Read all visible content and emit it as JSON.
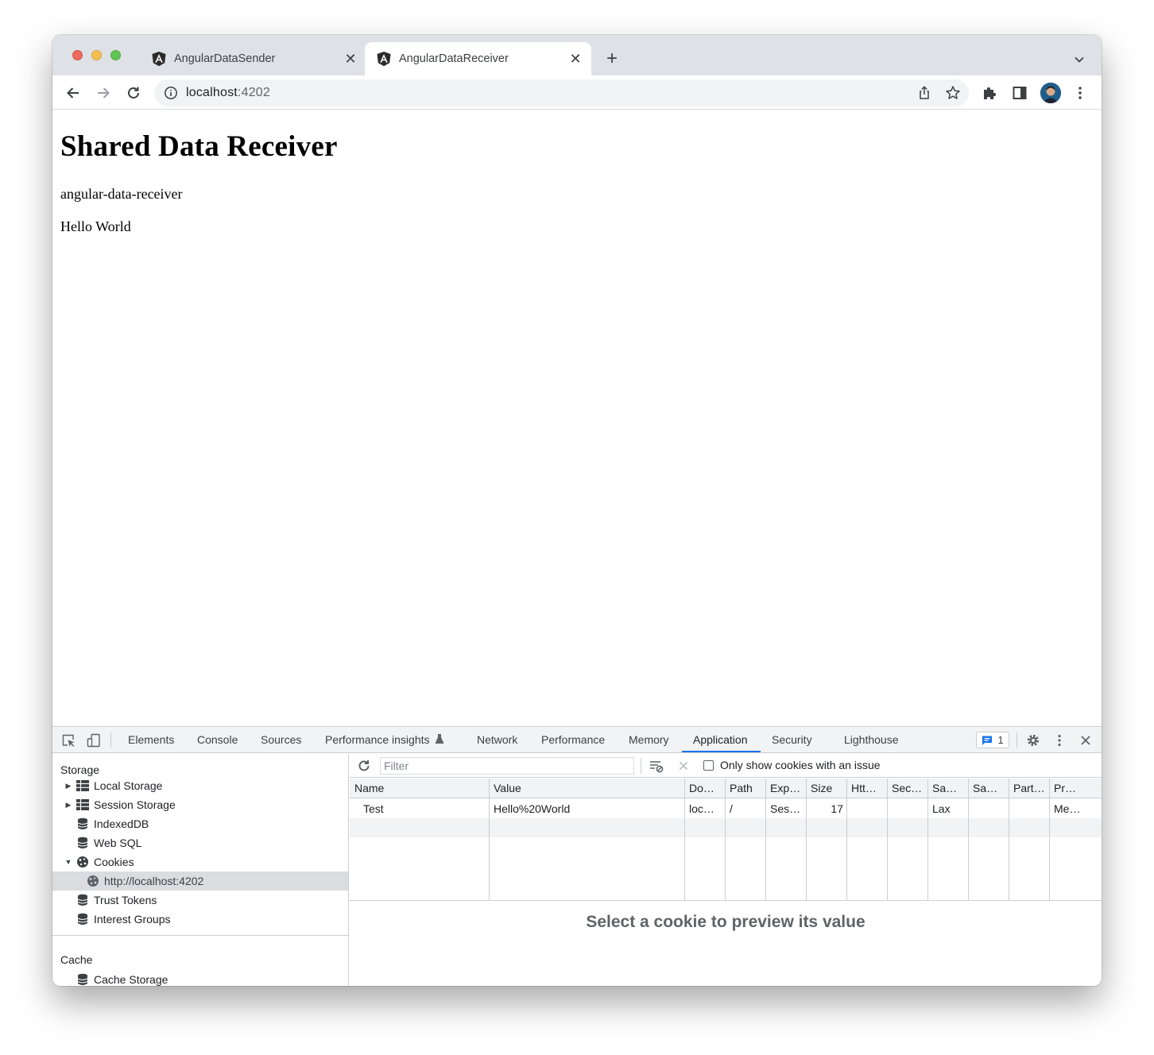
{
  "browser": {
    "tabs": [
      {
        "title": "AngularDataSender",
        "active": false
      },
      {
        "title": "AngularDataReceiver",
        "active": true
      }
    ],
    "url_host": "localhost",
    "url_port": ":4202"
  },
  "page": {
    "heading": "Shared Data Receiver",
    "app_name": "angular-data-receiver",
    "message": "Hello World"
  },
  "devtools": {
    "tabs": [
      "Elements",
      "Console",
      "Sources",
      "Performance insights",
      "Network",
      "Performance",
      "Memory",
      "Application",
      "Security",
      "Lighthouse"
    ],
    "active_tab": "Application",
    "issues_count": "1",
    "sidebar": {
      "storage_heading": "Storage",
      "items": [
        {
          "label": "Local Storage",
          "icon": "grid-icon",
          "expandable": true
        },
        {
          "label": "Session Storage",
          "icon": "grid-icon",
          "expandable": true
        },
        {
          "label": "IndexedDB",
          "icon": "database-icon"
        },
        {
          "label": "Web SQL",
          "icon": "database-icon"
        },
        {
          "label": "Cookies",
          "icon": "cookie-icon",
          "expanded": true
        },
        {
          "label": "http://localhost:4202",
          "icon": "cookie-icon",
          "selected": true
        },
        {
          "label": "Trust Tokens",
          "icon": "database-icon"
        },
        {
          "label": "Interest Groups",
          "icon": "database-icon"
        }
      ],
      "cache_heading": "Cache",
      "cache_items": [
        {
          "label": "Cache Storage",
          "icon": "database-icon"
        }
      ]
    },
    "cookies": {
      "filter_placeholder": "Filter",
      "only_issue_label": "Only show cookies with an issue",
      "columns": [
        "Name",
        "Value",
        "Do…",
        "Path",
        "Exp…",
        "Size",
        "Htt…",
        "Sec…",
        "Sa…",
        "Sa…",
        "Part…",
        "Pr…"
      ],
      "rows": [
        [
          "Test",
          "Hello%20World",
          "loc…",
          "/",
          "Ses…",
          "17",
          "",
          "",
          "Lax",
          "",
          "",
          "Me…"
        ]
      ],
      "preview_message": "Select a cookie to preview its value"
    }
  }
}
